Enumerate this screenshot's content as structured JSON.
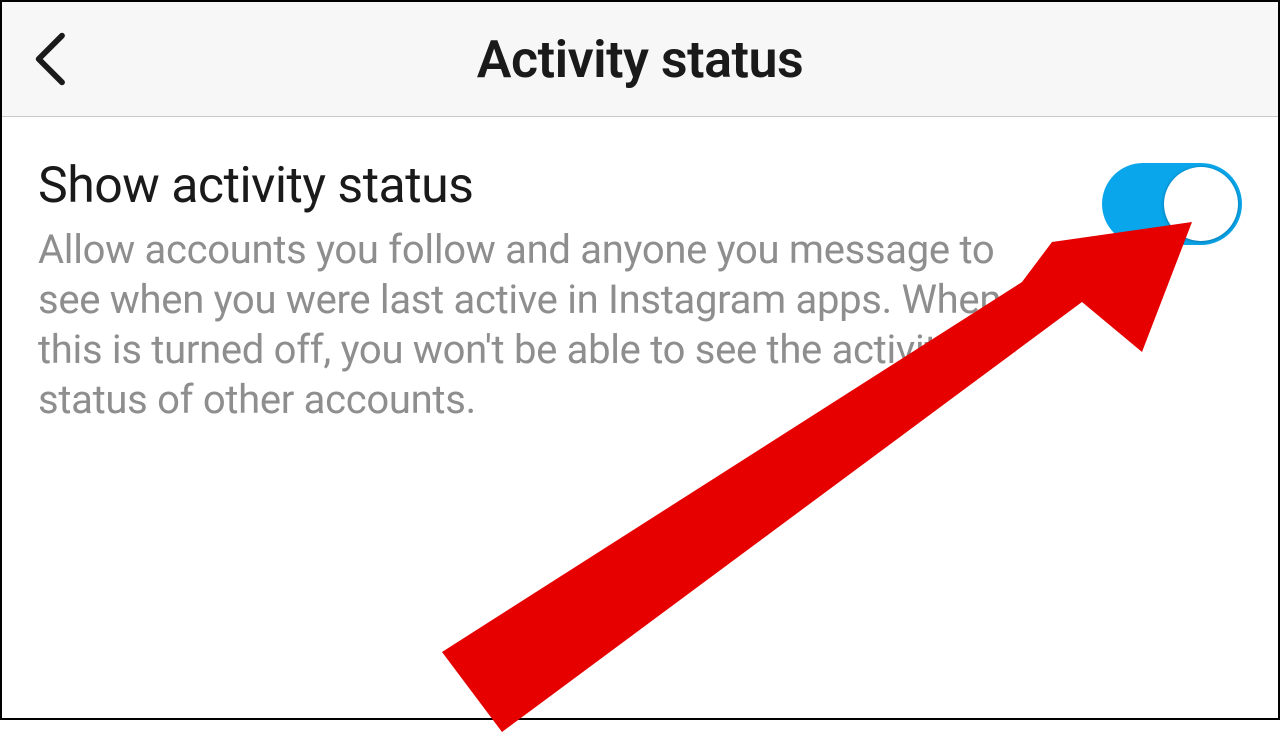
{
  "header": {
    "title": "Activity status"
  },
  "setting": {
    "title": "Show activity status",
    "description": "Allow accounts you follow and anyone you message to see when you were last active in Instagram apps. When this is turned off, you won't be able to see the activity status of other accounts.",
    "toggle_on": true
  },
  "colors": {
    "toggle_on": "#0aa6ec",
    "arrow": "#e60000",
    "text_primary": "#1a1a1a",
    "text_secondary": "#8e8e8e",
    "header_bg": "#f7f7f7"
  },
  "overlay": {
    "type": "arrow",
    "points_to": "toggle"
  }
}
